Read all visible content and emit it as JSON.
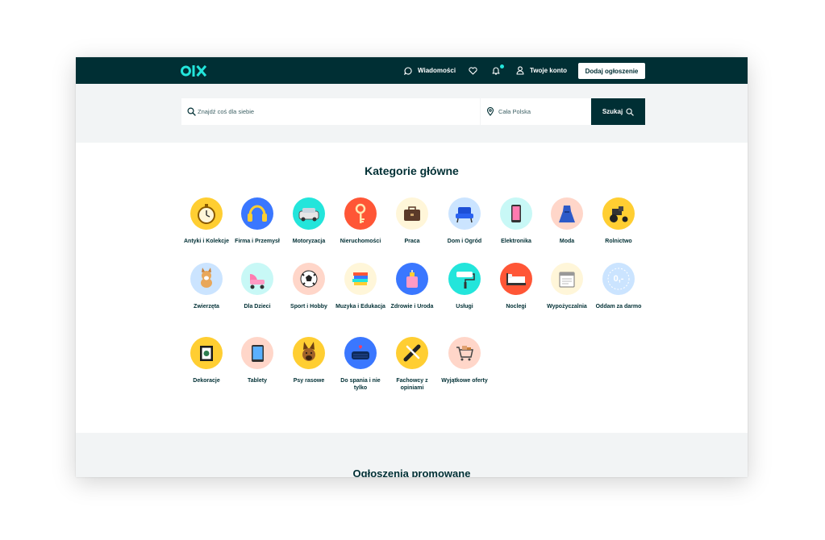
{
  "header": {
    "logo_text": "OLX",
    "nav": {
      "messages": "Wiadomości",
      "account": "Twoje konto"
    },
    "add_button": "Dodaj ogłoszenie"
  },
  "search": {
    "placeholder": "Znajdź coś dla siebie",
    "location": "Cała Polska",
    "button": "Szukaj"
  },
  "categories_section": {
    "title": "Kategorie główne",
    "items": [
      {
        "label": "Antyki i Kolekcje",
        "color": "#ffce32",
        "icon": "pocket-watch-icon"
      },
      {
        "label": "Firma i Przemysł",
        "color": "#3a77ff",
        "icon": "ear-protectors-icon"
      },
      {
        "label": "Motoryzacja",
        "color": "#23e5db",
        "icon": "car-icon"
      },
      {
        "label": "Nieruchomości",
        "color": "#ff5636",
        "icon": "key-icon"
      },
      {
        "label": "Praca",
        "color": "#fff6d9",
        "icon": "briefcase-icon"
      },
      {
        "label": "Dom i Ogród",
        "color": "#cbe4ff",
        "icon": "armchair-icon"
      },
      {
        "label": "Elektronika",
        "color": "#c8f8f6",
        "icon": "smartphone-icon"
      },
      {
        "label": "Moda",
        "color": "#ffd6c9",
        "icon": "dress-icon"
      },
      {
        "label": "Rolnictwo",
        "color": "#ffce32",
        "icon": "tractor-icon"
      },
      {
        "label": "Zwierzęta",
        "color": "#cbe4ff",
        "icon": "dog-icon"
      },
      {
        "label": "Dla Dzieci",
        "color": "#c8f8f6",
        "icon": "stroller-icon"
      },
      {
        "label": "Sport i Hobby",
        "color": "#ffd6c9",
        "icon": "soccer-ball-icon"
      },
      {
        "label": "Muzyka i Edukacja",
        "color": "#fff6d9",
        "icon": "books-icon"
      },
      {
        "label": "Zdrowie i Uroda",
        "color": "#3a77ff",
        "icon": "perfume-icon"
      },
      {
        "label": "Usługi",
        "color": "#23e5db",
        "icon": "paint-roller-icon"
      },
      {
        "label": "Noclegi",
        "color": "#ff5636",
        "icon": "bed-icon"
      },
      {
        "label": "Wypożyczalnia",
        "color": "#fff6d9",
        "icon": "calendar-icon"
      },
      {
        "label": "Oddam za darmo",
        "color": "#cbe4ff",
        "icon": "zero-price-icon",
        "badge": "0,-"
      },
      {
        "label": "Dekoracje",
        "color": "#ffce32",
        "icon": "picture-frame-icon"
      },
      {
        "label": "Tablety",
        "color": "#ffd6c9",
        "icon": "tablet-icon"
      },
      {
        "label": "Psy rasowe",
        "color": "#ffce32",
        "icon": "shepherd-dog-icon"
      },
      {
        "label": "Do spania i nie tylko",
        "color": "#3a77ff",
        "icon": "mattress-icon"
      },
      {
        "label": "Fachowcy z opiniami",
        "color": "#ffce32",
        "icon": "tools-icon"
      },
      {
        "label": "Wyjątkowe oferty",
        "color": "#ffd6c9",
        "icon": "shopping-cart-icon"
      }
    ]
  },
  "promoted": {
    "title": "Ogłoszenia promowane"
  },
  "colors": {
    "brand_dark": "#002f34",
    "accent_teal": "#23e5db",
    "background_grey": "#f2f4f5"
  }
}
